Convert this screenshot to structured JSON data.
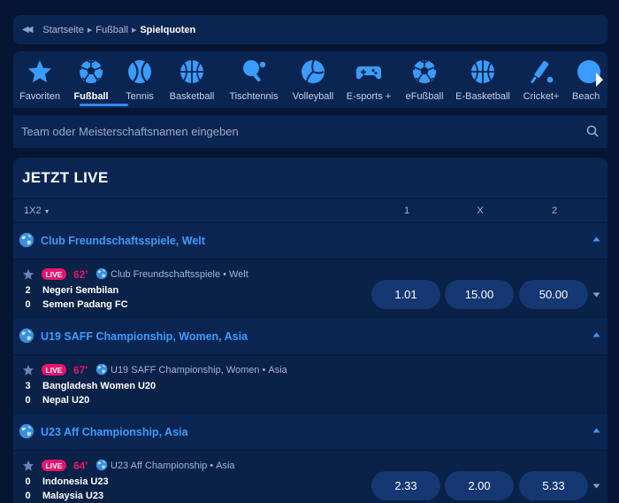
{
  "breadcrumb": {
    "home": "Startseite",
    "sport": "Fußball",
    "current": "Spielquoten"
  },
  "sports": [
    {
      "label": "Favoriten",
      "icon": "star-icon"
    },
    {
      "label": "Fußball",
      "icon": "soccer-ball-icon",
      "active": true
    },
    {
      "label": "Tennis",
      "icon": "tennis-ball-icon"
    },
    {
      "label": "Basketball",
      "icon": "basketball-icon"
    },
    {
      "label": "Tischtennis",
      "icon": "table-tennis-icon"
    },
    {
      "label": "Volleyball",
      "icon": "volleyball-icon"
    },
    {
      "label": "E-sports +",
      "icon": "gamepad-icon"
    },
    {
      "label": "eFußball",
      "icon": "soccer-ball-icon"
    },
    {
      "label": "E-Basketball",
      "icon": "basketball-icon"
    },
    {
      "label": "Cricket+",
      "icon": "cricket-bat-icon"
    },
    {
      "label": "Beach",
      "icon": "beach-volleyball-icon"
    }
  ],
  "search": {
    "placeholder": "Team oder Meisterschaftsnamen eingeben"
  },
  "live": {
    "title": "JETZT LIVE",
    "market": "1X2",
    "columns": [
      "1",
      "X",
      "2"
    ],
    "badge": "LIVE",
    "sections": [
      {
        "league": "Club Freundschaftsspiele, Welt",
        "match": {
          "minute": "62'",
          "league": "Club Freundschaftsspiele",
          "region": "Welt",
          "team1": {
            "score": "2",
            "name": "Negeri Sembilan"
          },
          "team2": {
            "score": "0",
            "name": "Semen Padang FC"
          },
          "odds": [
            "1.01",
            "15.00",
            "50.00"
          ]
        }
      },
      {
        "league": "U19 SAFF Championship, Women, Asia",
        "match": {
          "minute": "67'",
          "league": "U19 SAFF Championship, Women",
          "region": "Asia",
          "team1": {
            "score": "3",
            "name": "Bangladesh Women U20"
          },
          "team2": {
            "score": "0",
            "name": "Nepal U20"
          },
          "odds": []
        }
      },
      {
        "league": "U23 Aff Championship, Asia",
        "match": {
          "minute": "64'",
          "league": "U23 Aff Championship",
          "region": "Asia",
          "team1": {
            "score": "0",
            "name": "Indonesia U23"
          },
          "team2": {
            "score": "0",
            "name": "Malaysia U23"
          },
          "odds": [
            "2.33",
            "2.00",
            "5.33"
          ]
        }
      }
    ]
  },
  "colors": {
    "accent": "#2d8cff",
    "live": "#e8156f",
    "odd_bg": "#153872",
    "panel": "#0b2552"
  }
}
